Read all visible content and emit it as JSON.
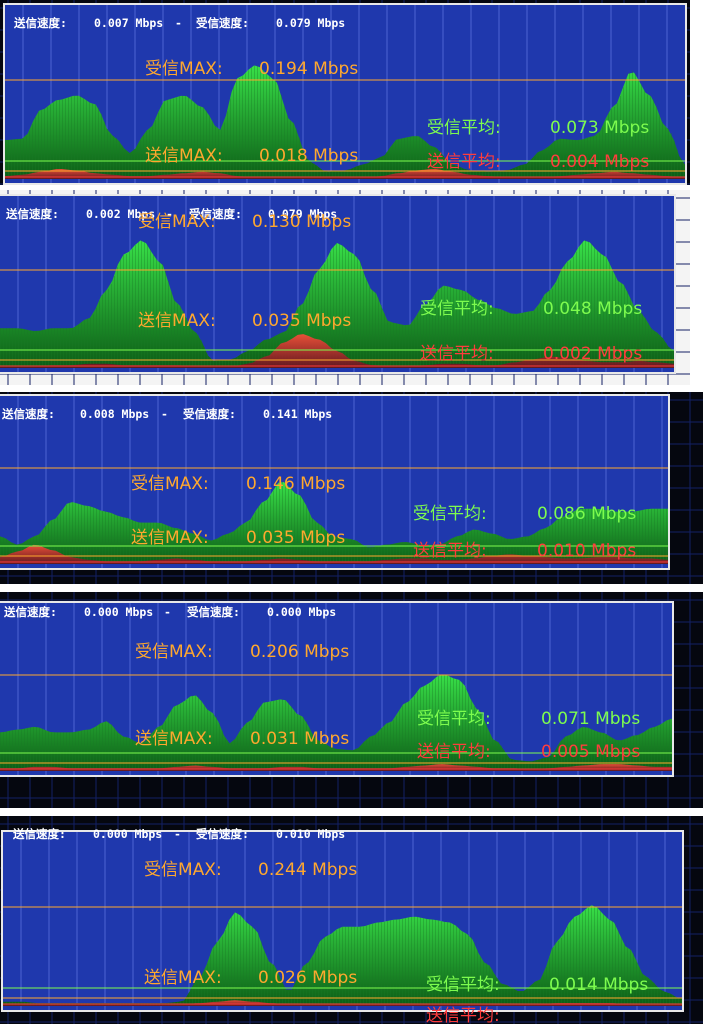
{
  "colors": {
    "bg": "#1f38ad",
    "grid": "#4d63d2",
    "orange": "#ffa82e",
    "green": "#7dfc4e",
    "red": "#ff3c3c",
    "fill_top": "#38e048",
    "fill_bottom": "#0c5c16",
    "outer": "#05070f"
  },
  "panels": [
    {
      "send_speed_label": "送信速度:",
      "send_speed": "0.007 Mbps",
      "separator": "-",
      "recv_speed_label": "受信速度:",
      "recv_speed": "0.079 Mbps",
      "recv_max_label": "受信MAX:",
      "recv_max": "0.194 Mbps",
      "send_max_label": "送信MAX:",
      "send_max": "0.018 Mbps",
      "recv_avg_label": "受信平均:",
      "recv_avg": "0.073 Mbps",
      "send_avg_label": "送信平均:",
      "send_avg": "0.004 Mbps",
      "recv_curve": [
        0.27,
        0.28,
        0.48,
        0.55,
        0.58,
        0.52,
        0.3,
        0.18,
        0.34,
        0.55,
        0.58,
        0.5,
        0.34,
        0.7,
        0.79,
        0.7,
        0.4,
        0.12,
        0.05,
        0.06,
        0.1,
        0.15,
        0.28,
        0.3,
        0.22,
        0.1,
        0.06,
        0.05,
        0.06,
        0.1,
        0.2,
        0.28,
        0.27,
        0.3,
        0.5,
        0.75,
        0.58,
        0.35,
        0.1
      ],
      "send_curve": [
        0.02,
        0.03,
        0.05,
        0.07,
        0.06,
        0.04,
        0.03,
        0.02,
        0.02,
        0.03,
        0.04,
        0.05,
        0.04,
        0.02,
        0.01,
        0.01,
        0.01,
        0.01,
        0.01,
        0.01,
        0.01,
        0.02,
        0.04,
        0.06,
        0.07,
        0.05,
        0.03,
        0.02,
        0.01,
        0.01,
        0.01,
        0.02,
        0.03,
        0.04,
        0.05,
        0.04,
        0.03,
        0.02,
        0.01
      ]
    },
    {
      "send_speed_label": "送信速度:",
      "send_speed": "0.002 Mbps",
      "separator": "-",
      "recv_speed_label": "受信速度:",
      "recv_speed": "0.079 Mbps",
      "recv_max_label": "受信MAX:",
      "recv_max": "0.130 Mbps",
      "send_max_label": "送信MAX:",
      "send_max": "0.035 Mbps",
      "recv_avg_label": "受信平均:",
      "recv_avg": "0.048 Mbps",
      "send_avg_label": "送信平均:",
      "send_avg": "0.002 Mbps",
      "recv_curve": [
        0.28,
        0.28,
        0.26,
        0.28,
        0.28,
        0.35,
        0.55,
        0.8,
        0.9,
        0.75,
        0.45,
        0.25,
        0.05,
        0.06,
        0.12,
        0.2,
        0.25,
        0.45,
        0.7,
        0.88,
        0.8,
        0.55,
        0.32,
        0.3,
        0.45,
        0.58,
        0.55,
        0.48,
        0.42,
        0.38,
        0.4,
        0.55,
        0.75,
        0.9,
        0.8,
        0.6,
        0.4,
        0.25,
        0.12
      ],
      "send_curve": [
        0.01,
        0.01,
        0.01,
        0.02,
        0.02,
        0.03,
        0.03,
        0.02,
        0.02,
        0.02,
        0.02,
        0.01,
        0.01,
        0.01,
        0.03,
        0.08,
        0.18,
        0.24,
        0.2,
        0.12,
        0.05,
        0.02,
        0.01,
        0.01,
        0.02,
        0.03,
        0.03,
        0.02,
        0.02,
        0.04,
        0.06,
        0.08,
        0.07,
        0.05,
        0.04,
        0.04,
        0.05,
        0.04,
        0.03
      ]
    },
    {
      "send_speed_label": "送信速度:",
      "send_speed": "0.008 Mbps",
      "separator": "-",
      "recv_speed_label": "受信速度:",
      "recv_speed": "0.141 Mbps",
      "recv_max_label": "受信MAX:",
      "recv_max": "0.146 Mbps",
      "send_max_label": "送信MAX:",
      "send_max": "0.035 Mbps",
      "recv_avg_label": "受信平均:",
      "recv_avg": "0.086 Mbps",
      "send_avg_label": "送信平均:",
      "send_avg": "0.010 Mbps",
      "recv_curve": [
        0.2,
        0.14,
        0.2,
        0.32,
        0.45,
        0.42,
        0.38,
        0.34,
        0.3,
        0.3,
        0.26,
        0.22,
        0.17,
        0.22,
        0.3,
        0.45,
        0.6,
        0.5,
        0.3,
        0.2,
        0.18,
        0.12,
        0.14,
        0.16,
        0.14,
        0.14,
        0.2,
        0.25,
        0.22,
        0.18,
        0.2,
        0.26,
        0.34,
        0.4,
        0.4,
        0.38,
        0.38,
        0.4,
        0.4
      ],
      "send_curve": [
        0.05,
        0.09,
        0.14,
        0.1,
        0.05,
        0.03,
        0.02,
        0.02,
        0.02,
        0.03,
        0.04,
        0.03,
        0.02,
        0.02,
        0.02,
        0.03,
        0.04,
        0.03,
        0.02,
        0.02,
        0.02,
        0.02,
        0.03,
        0.04,
        0.04,
        0.03,
        0.03,
        0.04,
        0.06,
        0.07,
        0.06,
        0.05,
        0.04,
        0.04,
        0.05,
        0.05,
        0.04,
        0.04,
        0.03
      ]
    },
    {
      "send_speed_label": "送信速度:",
      "send_speed": "0.000 Mbps",
      "separator": "-",
      "recv_speed_label": "受信速度:",
      "recv_speed": "0.000 Mbps",
      "recv_max_label": "受信MAX:",
      "recv_max": "0.206 Mbps",
      "send_max_label": "送信MAX:",
      "send_max": "0.031 Mbps",
      "recv_avg_label": "受信平均:",
      "recv_avg": "0.071 Mbps",
      "send_avg_label": "送信平均:",
      "send_avg": "0.005 Mbps",
      "recv_curve": [
        0.28,
        0.3,
        0.32,
        0.28,
        0.28,
        0.3,
        0.36,
        0.25,
        0.2,
        0.32,
        0.48,
        0.55,
        0.42,
        0.2,
        0.35,
        0.5,
        0.52,
        0.4,
        0.22,
        0.16,
        0.15,
        0.25,
        0.35,
        0.5,
        0.62,
        0.7,
        0.66,
        0.45,
        0.22,
        0.08,
        0.07,
        0.1,
        0.25,
        0.32,
        0.28,
        0.22,
        0.26,
        0.32,
        0.38
      ],
      "send_curve": [
        0.02,
        0.02,
        0.03,
        0.03,
        0.02,
        0.02,
        0.02,
        0.02,
        0.02,
        0.02,
        0.03,
        0.04,
        0.03,
        0.02,
        0.02,
        0.02,
        0.03,
        0.03,
        0.02,
        0.02,
        0.02,
        0.02,
        0.02,
        0.03,
        0.04,
        0.05,
        0.04,
        0.03,
        0.02,
        0.02,
        0.01,
        0.02,
        0.03,
        0.04,
        0.05,
        0.05,
        0.04,
        0.03,
        0.03
      ]
    },
    {
      "send_speed_label": "送信速度:",
      "send_speed": "0.000 Mbps",
      "separator": "-",
      "recv_speed_label": "受信速度:",
      "recv_speed": "0.010 Mbps",
      "recv_max_label": "受信MAX:",
      "recv_max": "0.244 Mbps",
      "send_max_label": "送信MAX:",
      "send_max": "0.026 Mbps",
      "recv_avg_label": "受信平均:",
      "recv_avg": "0.014 Mbps",
      "send_avg_label": "送信平均:",
      "send_avg": "",
      "recv_curve": [
        0.03,
        0.03,
        0.02,
        0.02,
        0.02,
        0.02,
        0.02,
        0.02,
        0.02,
        0.02,
        0.03,
        0.2,
        0.45,
        0.65,
        0.55,
        0.3,
        0.1,
        0.3,
        0.48,
        0.55,
        0.55,
        0.58,
        0.6,
        0.62,
        0.6,
        0.58,
        0.5,
        0.3,
        0.15,
        0.1,
        0.18,
        0.45,
        0.62,
        0.7,
        0.6,
        0.4,
        0.2,
        0.1,
        0.05
      ],
      "send_curve": [
        0.01,
        0.01,
        0.01,
        0.01,
        0.01,
        0.01,
        0.01,
        0.01,
        0.01,
        0.01,
        0.01,
        0.02,
        0.03,
        0.04,
        0.03,
        0.02,
        0.01,
        0.01,
        0.01,
        0.01,
        0.01,
        0.01,
        0.01,
        0.01,
        0.01,
        0.01,
        0.01,
        0.01,
        0.01,
        0.01,
        0.01,
        0.02,
        0.02,
        0.02,
        0.02,
        0.01,
        0.01,
        0.01,
        0.01
      ]
    }
  ]
}
